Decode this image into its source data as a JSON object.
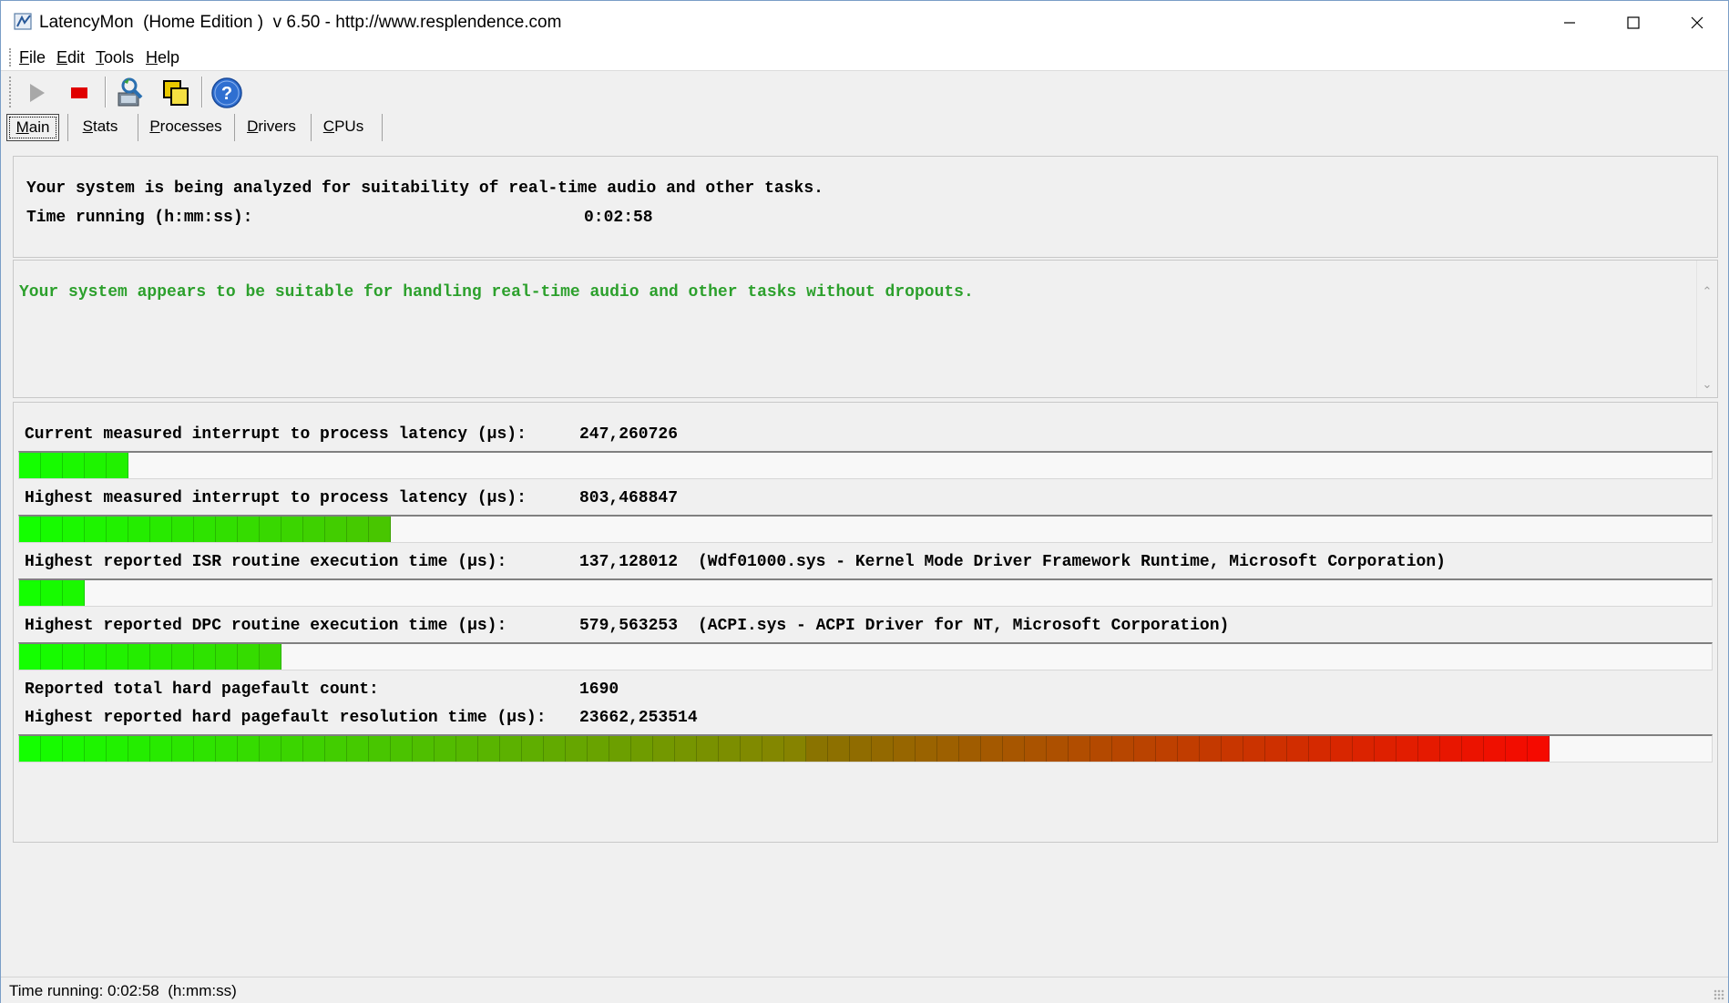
{
  "window": {
    "title": "LatencyMon  (Home Edition )  v 6.50 - http://www.resplendence.com",
    "minimize_icon": "minimize-icon",
    "maximize_icon": "maximize-icon",
    "close_icon": "close-icon"
  },
  "menu": {
    "items": [
      {
        "accel": "F",
        "rest": "ile"
      },
      {
        "accel": "E",
        "rest": "dit"
      },
      {
        "accel": "T",
        "rest": "ools"
      },
      {
        "accel": "H",
        "rest": "elp"
      }
    ]
  },
  "toolbar": {
    "buttons": [
      "play-icon",
      "stop-icon",
      "analyze-icon",
      "window-icon",
      "help-icon"
    ]
  },
  "tabs": {
    "items": [
      {
        "accel": "M",
        "rest": "ain",
        "active": true
      },
      {
        "accel": "S",
        "rest": "tats",
        "active": false
      },
      {
        "accel": "P",
        "rest": "rocesses",
        "active": false
      },
      {
        "accel": "D",
        "rest": "rivers",
        "active": false
      },
      {
        "accel": "C",
        "rest": "PUs",
        "active": false
      }
    ]
  },
  "status_panel": {
    "line1": "Your system is being analyzed for suitability of real-time audio and other tasks.",
    "time_label": "Time running (h:mm:ss):",
    "time_value": "0:02:58"
  },
  "verdict": {
    "message": "Your system appears to be suitable for handling real-time audio and other tasks without dropouts.",
    "color": "#2ca02c"
  },
  "metrics": [
    {
      "label": "Current measured interrupt to process latency (µs):",
      "value": "247,260726",
      "extra": "",
      "bar_segments": 5,
      "bar_total_segments": 73
    },
    {
      "label": "Highest measured interrupt to process latency (µs):",
      "value": "803,468847",
      "extra": "",
      "bar_segments": 17,
      "bar_total_segments": 73
    },
    {
      "label": "Highest reported ISR routine execution time (µs):",
      "value": "137,128012",
      "extra": "(Wdf01000.sys - Kernel Mode Driver Framework Runtime, Microsoft Corporation)",
      "bar_segments": 3,
      "bar_total_segments": 73
    },
    {
      "label": "Highest reported DPC routine execution time (µs):",
      "value": "579,563253",
      "extra": "(ACPI.sys - ACPI Driver for NT, Microsoft Corporation)",
      "bar_segments": 12,
      "bar_total_segments": 73
    }
  ],
  "pagefault": {
    "count_label": "Reported total hard pagefault count:",
    "count_value": "1690",
    "time_label": "Highest reported hard pagefault resolution time (µs):",
    "time_value": "23662,253514",
    "bar_segments": 70,
    "bar_total_segments": 73
  },
  "statusbar": {
    "text": "Time running: 0:02:58  (h:mm:ss)"
  }
}
